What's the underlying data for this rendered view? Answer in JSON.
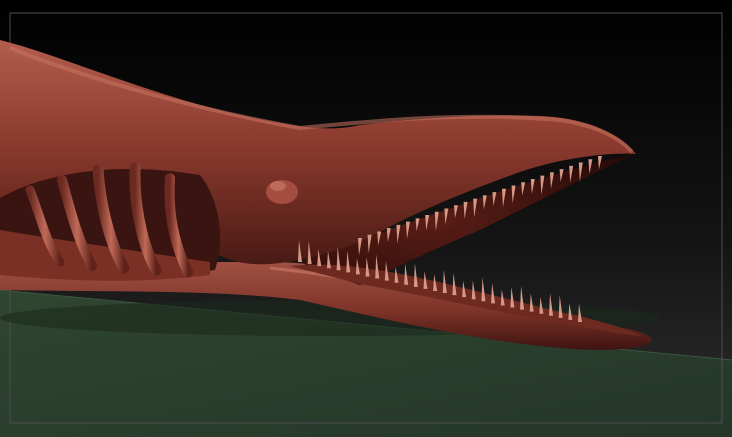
{
  "scene": {
    "subject": "sculpted-creature-head",
    "colors": {
      "skin": "#8a3a2e",
      "skin_highlight": "#b86252",
      "skin_shadow": "#3e1410",
      "tooth": "#d59886",
      "floor": "#304632",
      "background_top": "#000000",
      "background_bottom": "#2a2a2a",
      "frame": "#5a5a5a"
    }
  }
}
